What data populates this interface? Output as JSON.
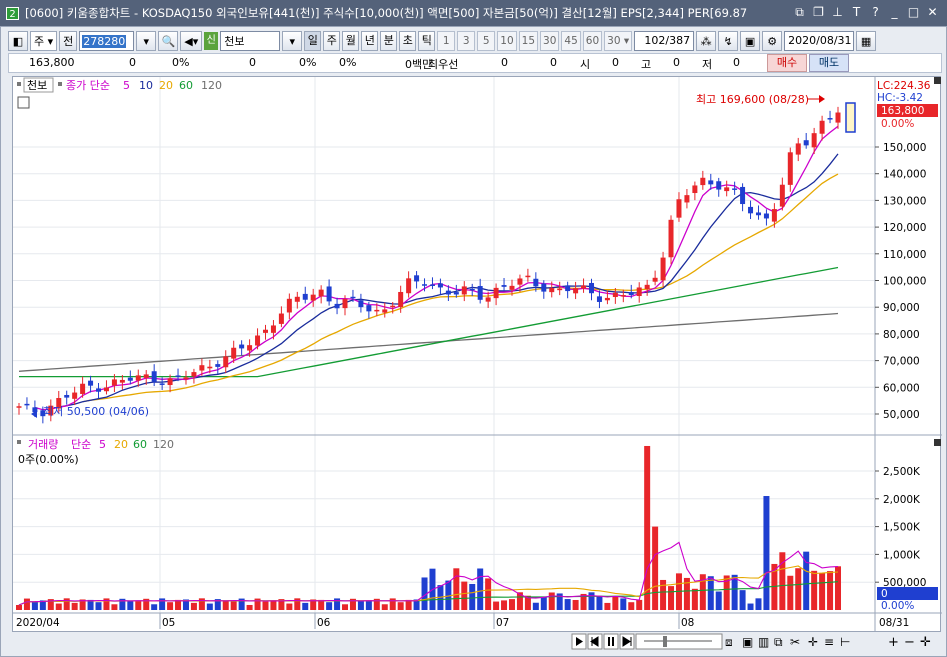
{
  "window": {
    "title": "[0600] 키움종합차트 - KOSDAQ150 외국인보유[441(천)] 주식수[10,000(천)] 액면[500] 자본금[50(억)] 결산[12월] EPS[2,344] PER[69.87",
    "icon_label": "2"
  },
  "toolbar": {
    "type_label": "주",
    "kind_label": "전",
    "code": "278280",
    "sin_label": "신",
    "name": "천보",
    "periods": [
      "일",
      "주",
      "월",
      "년",
      "분",
      "초",
      "틱"
    ],
    "active_period": "일",
    "numbers": [
      "1",
      "3",
      "5",
      "10",
      "15",
      "30",
      "45",
      "60"
    ],
    "interval_value": "30",
    "count": "102/387",
    "date": "2020/08/31"
  },
  "quote": {
    "price": "163,800",
    "change": "0",
    "change_pct": "0%",
    "volume": "0",
    "vol_pct": "0%",
    "extra_pct": "0%",
    "amount": "0백만",
    "priority": "최우선",
    "p1": "0",
    "p2": "0",
    "open_label": "시",
    "open": "0",
    "high_label": "고",
    "high": "0",
    "low_label": "저",
    "low": "0",
    "buy": "매수",
    "sell": "매도"
  },
  "price_panel": {
    "stock_label": "천보",
    "legend_title": "종가 단순",
    "ma_periods": [
      "5",
      "10",
      "20",
      "60",
      "120"
    ],
    "lc": "LC:224.36",
    "hc": "HC:-3.42",
    "current": "163,800",
    "current_pct": "0.00%",
    "high_note": "최고 169,600 (08/28)",
    "low_note": "최저 50,500 (04/06)"
  },
  "volume_panel": {
    "legend_title": "거래량",
    "legend_sub": "단순",
    "ma_periods": [
      "5",
      "20",
      "60",
      "120"
    ],
    "info": "0주(0.00%)",
    "current": "0",
    "current_pct": "0.00%"
  },
  "xaxis": {
    "months": [
      "2020/04",
      "05",
      "06",
      "07",
      "08"
    ],
    "end_date": "08/31"
  },
  "colors": {
    "up": "#e8262a",
    "down": "#1f3fd0",
    "ma5": "#cc00cc",
    "ma10": "#1a2c9c",
    "ma20": "#e6a800",
    "ma60": "#139c34",
    "ma120": "#6e6e6e"
  },
  "chart_data": {
    "type": "candlestick",
    "x_range": [
      "2020-04-01",
      "2020-08-31"
    ],
    "y_axis_ticks": [
      50000,
      60000,
      70000,
      80000,
      90000,
      100000,
      110000,
      120000,
      130000,
      140000,
      150000
    ],
    "volume_axis_ticks": [
      "500,000",
      "1,000K",
      "1,500K",
      "2,000K",
      "2,500K"
    ],
    "high": 169600,
    "low": 50500,
    "last_close": 163800
  }
}
